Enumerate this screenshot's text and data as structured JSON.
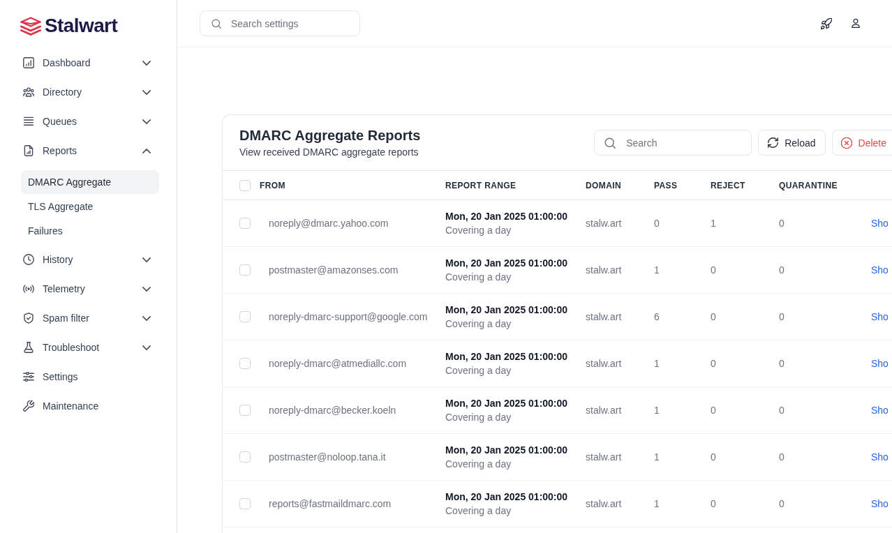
{
  "sidebar": {
    "brand": "Stalwart",
    "items": [
      {
        "label": "Dashboard",
        "kind": "group",
        "expanded": false
      },
      {
        "label": "Directory",
        "kind": "group",
        "expanded": false
      },
      {
        "label": "Queues",
        "kind": "group",
        "expanded": false
      },
      {
        "label": "Reports",
        "kind": "group",
        "expanded": true,
        "children": [
          {
            "label": "DMARC Aggregate",
            "selected": true
          },
          {
            "label": "TLS Aggregate",
            "selected": false
          },
          {
            "label": "Failures",
            "selected": false
          }
        ]
      },
      {
        "label": "History",
        "kind": "group",
        "expanded": false
      },
      {
        "label": "Telemetry",
        "kind": "group",
        "expanded": false
      },
      {
        "label": "Spam filter",
        "kind": "group",
        "expanded": false
      },
      {
        "label": "Troubleshoot",
        "kind": "group",
        "expanded": false
      },
      {
        "label": "Settings",
        "kind": "link"
      },
      {
        "label": "Maintenance",
        "kind": "link"
      }
    ]
  },
  "header": {
    "search": {
      "placeholder": "Search settings"
    }
  },
  "report": {
    "title": "DMARC Aggregate Reports",
    "subtitle": "View received DMARC aggregate reports",
    "search": {
      "placeholder": "Search"
    },
    "buttons": [
      {
        "label": "Reload",
        "kind": "reload"
      },
      {
        "label": "Delete",
        "kind": "delete"
      }
    ],
    "table": {
      "all_checked": false,
      "columns": [
        "FROM",
        "REPORT RANGE",
        "DOMAIN",
        "PASS",
        "REJECT",
        "QUARANTINE"
      ],
      "rows": [
        {
          "checked": false,
          "from": "noreply@dmarc.yahoo.com",
          "range_start": "Mon, 20 Jan 2025 01:00:00",
          "range_length": "Covering a day",
          "domain": "stalw.art",
          "pass": "0",
          "reject": "1",
          "quarantine": "0",
          "action": "Sho"
        },
        {
          "checked": false,
          "from": "postmaster@amazonses.com",
          "range_start": "Mon, 20 Jan 2025 01:00:00",
          "range_length": "Covering a day",
          "domain": "stalw.art",
          "pass": "1",
          "reject": "0",
          "quarantine": "0",
          "action": "Sho"
        },
        {
          "checked": false,
          "from": "noreply-dmarc-support@google.com",
          "range_start": "Mon, 20 Jan 2025 01:00:00",
          "range_length": "Covering a day",
          "domain": "stalw.art",
          "pass": "6",
          "reject": "0",
          "quarantine": "0",
          "action": "Sho"
        },
        {
          "checked": false,
          "from": "noreply-dmarc@atmediallc.com",
          "range_start": "Mon, 20 Jan 2025 01:00:00",
          "range_length": "Covering a day",
          "domain": "stalw.art",
          "pass": "1",
          "reject": "0",
          "quarantine": "0",
          "action": "Sho"
        },
        {
          "checked": false,
          "from": "noreply-dmarc@becker.koeln",
          "range_start": "Mon, 20 Jan 2025 01:00:00",
          "range_length": "Covering a day",
          "domain": "stalw.art",
          "pass": "1",
          "reject": "0",
          "quarantine": "0",
          "action": "Sho"
        },
        {
          "checked": false,
          "from": "postmaster@noloop.tana.it",
          "range_start": "Mon, 20 Jan 2025 01:00:00",
          "range_length": "Covering a day",
          "domain": "stalw.art",
          "pass": "1",
          "reject": "0",
          "quarantine": "0",
          "action": "Sho"
        },
        {
          "checked": false,
          "from": "reports@fastmaildmarc.com",
          "range_start": "Mon, 20 Jan 2025 01:00:00",
          "range_length": "Covering a day",
          "domain": "stalw.art",
          "pass": "1",
          "reject": "0",
          "quarantine": "0",
          "action": "Sho"
        }
      ]
    }
  }
}
